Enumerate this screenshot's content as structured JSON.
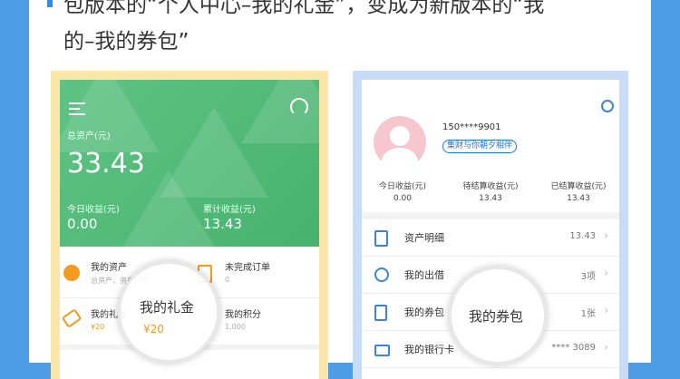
{
  "caption": {
    "line1": "包版本的“个人中心–我的礼金”，变成为新版本的“我",
    "line2": "的–我的券包”"
  },
  "left": {
    "total_label": "总资产(元)",
    "total_value": "33.43",
    "today_label": "今日收益(元)",
    "today_value": "0.00",
    "cum_label": "累计收益(元)",
    "cum_value": "13.43",
    "cells": [
      {
        "title": "我的资产",
        "sub": "总资产，资产明细"
      },
      {
        "title": "未完成订单",
        "sub": "0"
      },
      {
        "title": "我的礼金",
        "sub": "¥20"
      },
      {
        "title": "我的积分",
        "sub": "1,000"
      }
    ],
    "magnifier": {
      "title": "我的礼金",
      "value": "¥20"
    },
    "colors": {
      "green": "#52bb78"
    }
  },
  "right": {
    "phone": "150****9901",
    "tag": "集财与你朝夕相伴",
    "earnings": [
      {
        "label": "今日收益(元)",
        "value": "0.00"
      },
      {
        "label": "待结算收益(元)",
        "value": "13.43"
      },
      {
        "label": "已结算收益(元)",
        "value": "13.43"
      }
    ],
    "rows": [
      {
        "label": "资产明细",
        "value": "13.43",
        "icon": "document-icon"
      },
      {
        "label": "我的出借",
        "value": "3项",
        "icon": "pie-icon"
      },
      {
        "label": "我的券包",
        "value": "1张",
        "icon": "coupon-icon"
      },
      {
        "label": "我的银行卡",
        "value": "**** 3089",
        "icon": "card-icon"
      }
    ],
    "magnifier": {
      "title": "我的券包"
    }
  }
}
